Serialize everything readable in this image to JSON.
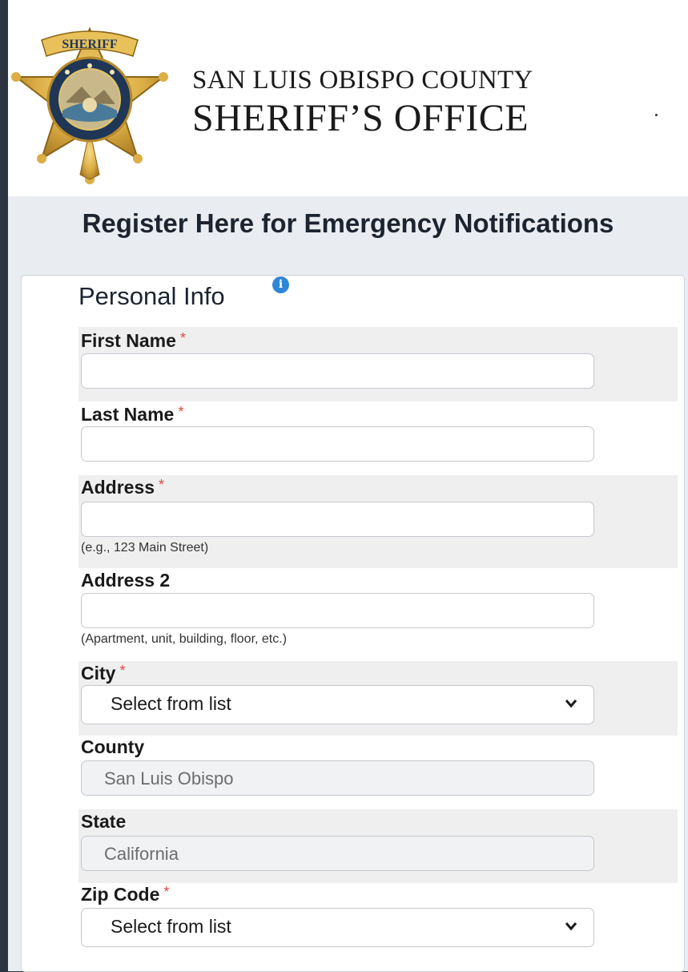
{
  "header": {
    "line1": "SAN LUIS OBISPO COUNTY",
    "line2": "SHERIFF’S OFFICE",
    "badge_text": "SHERIFF"
  },
  "page_heading": "Register Here for Emergency Notifications",
  "section": {
    "title": "Personal Info",
    "info_icon": "info-icon"
  },
  "required_mark": "*",
  "fields": {
    "first_name": {
      "label": "First Name",
      "value": ""
    },
    "last_name": {
      "label": "Last Name",
      "value": ""
    },
    "address": {
      "label": "Address",
      "value": "",
      "helper": "(e.g., 123 Main Street)"
    },
    "address2": {
      "label": "Address 2",
      "value": "",
      "helper": "(Apartment, unit, building, floor, etc.)"
    },
    "city": {
      "label": "City",
      "selected": "Select from list"
    },
    "county": {
      "label": "County",
      "value": "San Luis Obispo"
    },
    "state": {
      "label": "State",
      "value": "California"
    },
    "zip": {
      "label": "Zip Code",
      "selected": "Select from list"
    }
  },
  "colors": {
    "required": "#e04545",
    "info": "#2e86d6",
    "badge_gold": "#d9a93a"
  }
}
